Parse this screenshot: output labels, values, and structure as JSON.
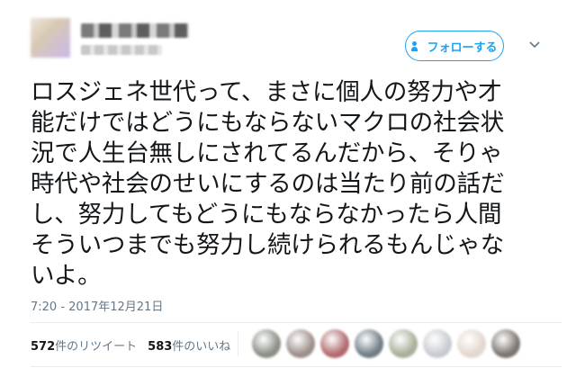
{
  "header": {
    "follow_label": "フォローする"
  },
  "tweet": {
    "text": "ロスジェネ世代って、まさに個人の努力や才\n能だけではどうにもならないマクロの社会状\n況で人生台無しにされてるんだから、そりゃ\n時代や社会のせいにするのは当たり前の話だ\nし、努力してもどうにもならなかったら人間\nそういつまでも努力し続けられるもんじゃな\nいよ。",
    "timestamp": "7:20 - 2017年12月21日"
  },
  "stats": {
    "retweet_count": "572",
    "retweet_label": "件のリツイート",
    "like_count": "583",
    "like_label": "件のいいね"
  },
  "likers": [
    {
      "color": "#8a8f86"
    },
    {
      "color": "#9c8f8a"
    },
    {
      "color": "#b06a6e"
    },
    {
      "color": "#6f7d86"
    },
    {
      "color": "#a7b09a"
    },
    {
      "color": "#c7cbd1"
    },
    {
      "color": "#e3d7cf"
    },
    {
      "color": "#7c756f"
    }
  ],
  "colors": {
    "accent": "#1da1f2",
    "text": "#14171a",
    "muted": "#657786"
  },
  "icons": {
    "follow": "add-user-icon",
    "menu": "chevron-down-icon"
  }
}
